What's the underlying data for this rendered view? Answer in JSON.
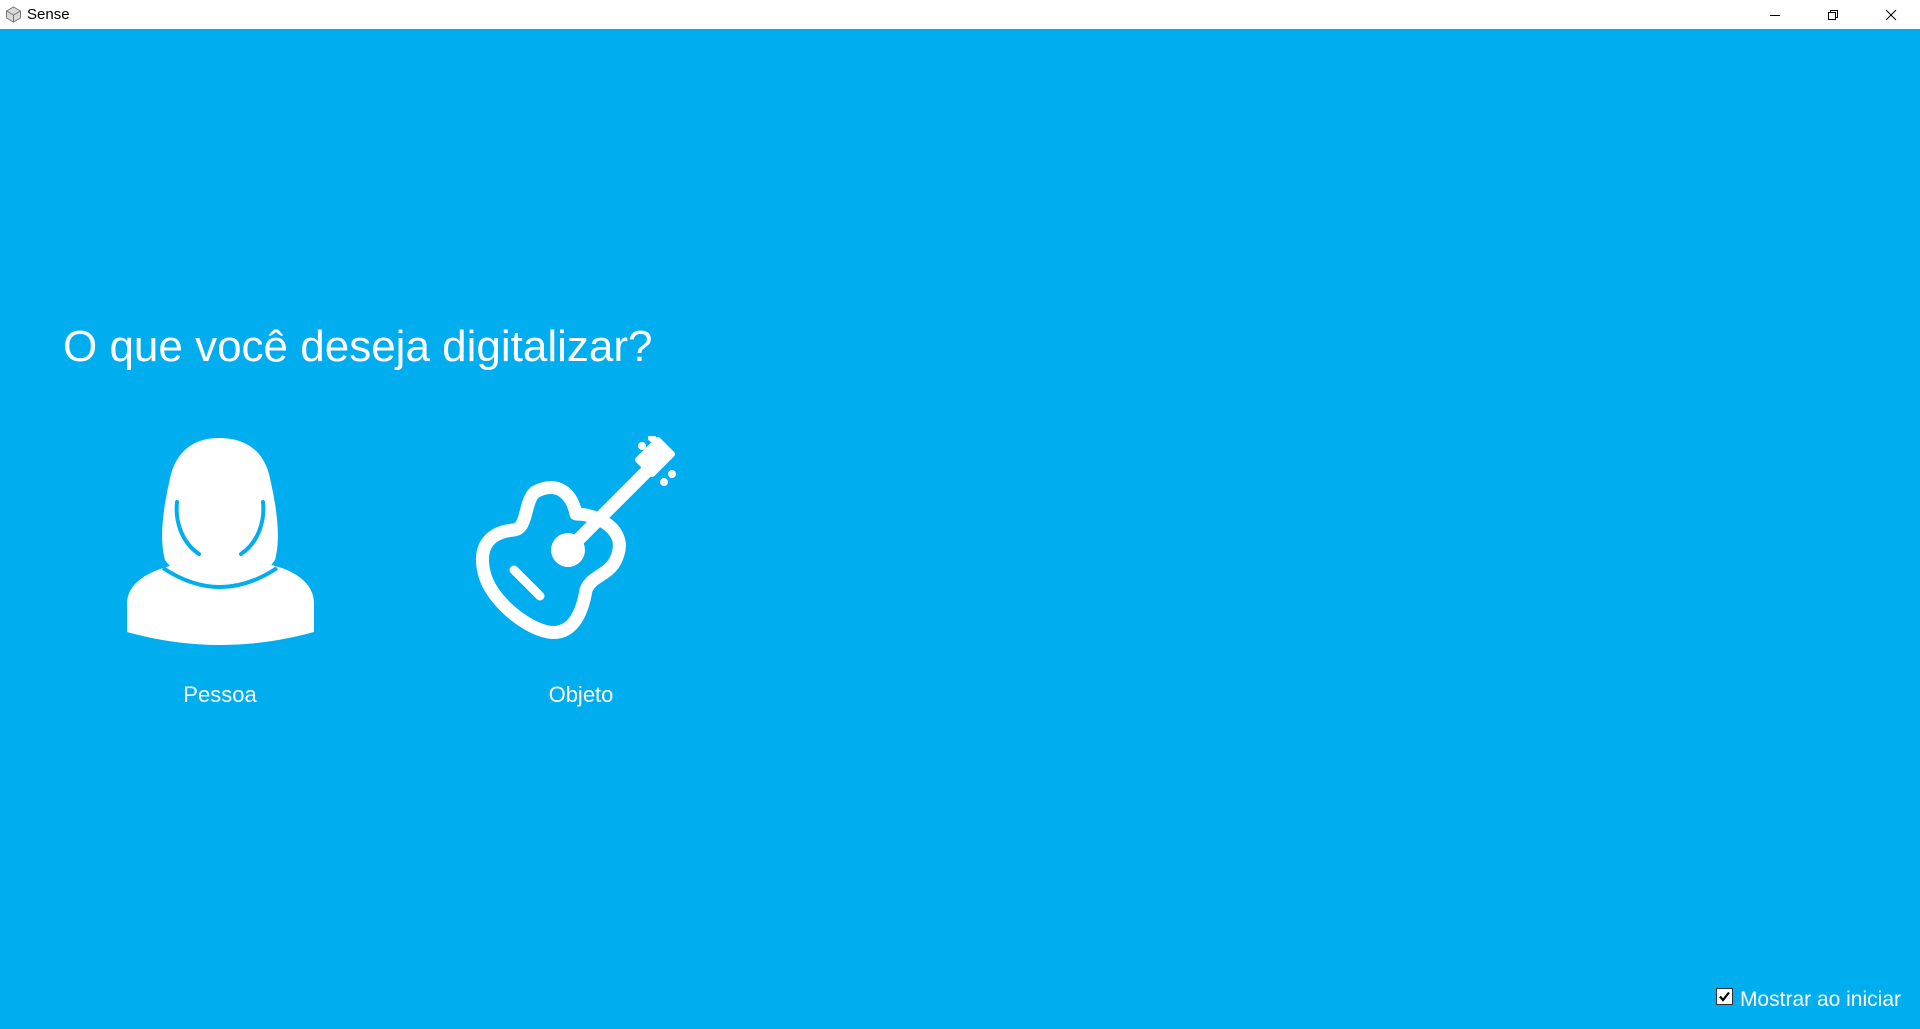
{
  "window": {
    "title": "Sense",
    "app_icon": "sense-logo-icon",
    "controls": [
      "minimize-icon",
      "restore-icon",
      "close-icon"
    ]
  },
  "main": {
    "heading": "O que você deseja digitalizar?",
    "options": [
      {
        "label": "Pessoa",
        "icon": "person-icon"
      },
      {
        "label": "Objeto",
        "icon": "guitar-icon"
      }
    ]
  },
  "footer": {
    "show_on_start_label": "Mostrar ao iniciar",
    "show_on_start_checked": true
  },
  "colors": {
    "background": "#00adef",
    "foreground": "#ffffff",
    "titlebar": "#ffffff"
  }
}
